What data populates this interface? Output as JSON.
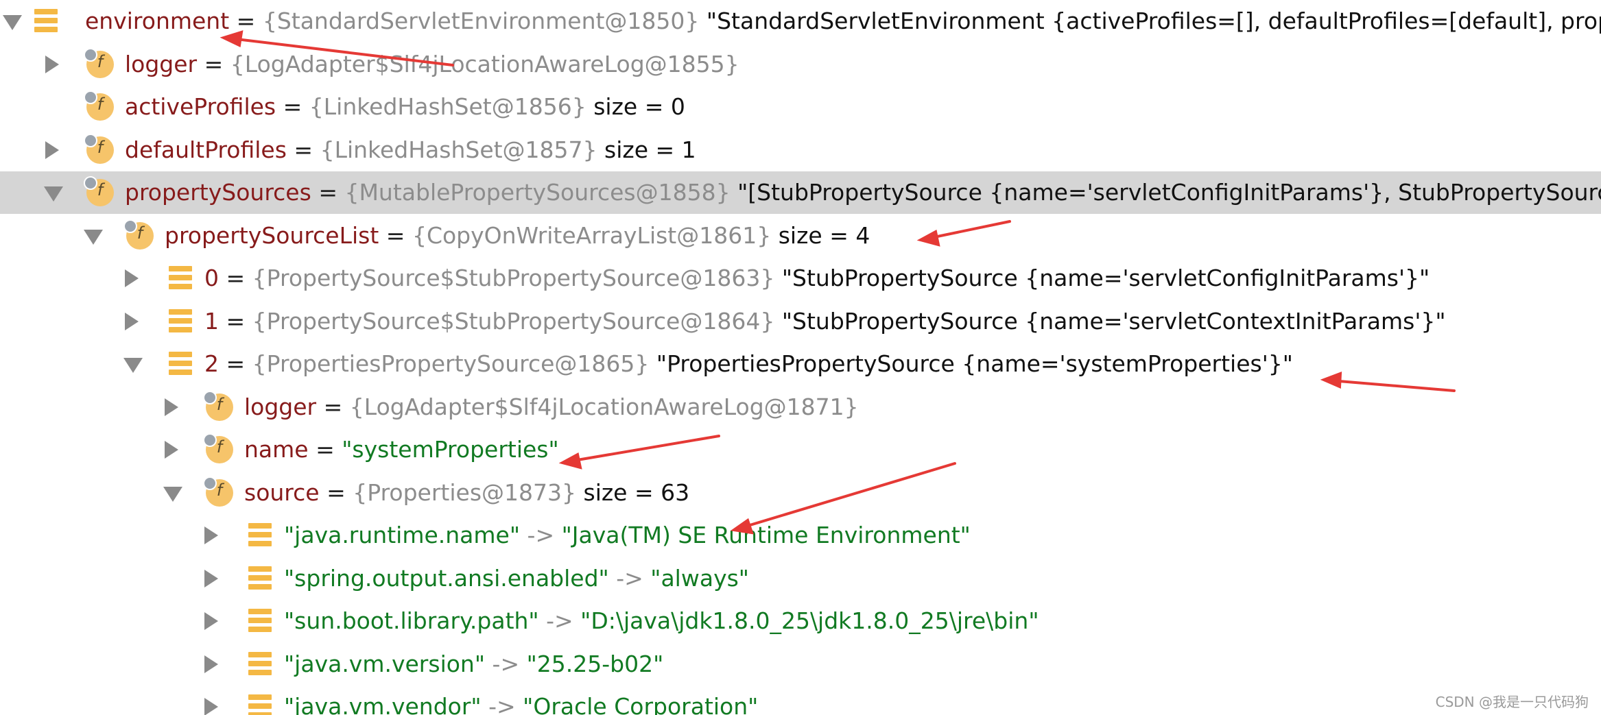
{
  "tree": {
    "rows": [
      {
        "name": "environment",
        "type": "{StandardServletEnvironment@1850}",
        "value": "\"StandardServletEnvironment {activeProfiles=[], defaultProfiles=[default], prope",
        "str": ""
      },
      {
        "name": "logger",
        "type": "{LogAdapter$Slf4jLocationAwareLog@1855}",
        "value": "",
        "str": ""
      },
      {
        "name": "activeProfiles",
        "type": "{LinkedHashSet@1856}",
        "value": "size = 0",
        "str": ""
      },
      {
        "name": "defaultProfiles",
        "type": "{LinkedHashSet@1857}",
        "value": "size = 1",
        "str": ""
      },
      {
        "name": "propertySources",
        "type": "{MutablePropertySources@1858}",
        "value": "\"[StubPropertySource {name='servletConfigInitParams'}, StubPropertySourc",
        "str": ""
      },
      {
        "name": "propertySourceList",
        "type": "{CopyOnWriteArrayList@1861}",
        "value": "size = 4",
        "str": ""
      },
      {
        "name": "0",
        "type": "{PropertySource$StubPropertySource@1863}",
        "value": "\"StubPropertySource {name='servletConfigInitParams'}\"",
        "str": ""
      },
      {
        "name": "1",
        "type": "{PropertySource$StubPropertySource@1864}",
        "value": "\"StubPropertySource {name='servletContextInitParams'}\"",
        "str": ""
      },
      {
        "name": "2",
        "type": "{PropertiesPropertySource@1865}",
        "value": "\"PropertiesPropertySource {name='systemProperties'}\"",
        "str": ""
      },
      {
        "name": "logger",
        "type": "{LogAdapter$Slf4jLocationAwareLog@1871}",
        "value": "",
        "str": ""
      },
      {
        "name": "name",
        "type": "",
        "value": "",
        "str": "\"systemProperties\""
      },
      {
        "name": "source",
        "type": "{Properties@1873}",
        "value": "size = 63",
        "str": ""
      },
      {
        "key": "\"java.runtime.name\"",
        "arrow": "->",
        "str": "\"Java(TM) SE Runtime Environment\""
      },
      {
        "key": "\"spring.output.ansi.enabled\"",
        "arrow": "->",
        "str": "\"always\""
      },
      {
        "key": "\"sun.boot.library.path\"",
        "arrow": "->",
        "str": "\"D:\\java\\jdk1.8.0_25\\jdk1.8.0_25\\jre\\bin\""
      },
      {
        "key": "\"java.vm.version\"",
        "arrow": "->",
        "str": "\"25.25-b02\""
      },
      {
        "key": "\"java.vm.vendor\"",
        "arrow": "->",
        "str": "\"Oracle Corporation\""
      }
    ],
    "equals": "="
  },
  "watermark": "CSDN @我是一只代码狗",
  "colors": {
    "name": "#871b1b",
    "type": "#8c8c8c",
    "string": "#117a22",
    "selection": "#d5d5d5",
    "annotation": "#e53935"
  }
}
